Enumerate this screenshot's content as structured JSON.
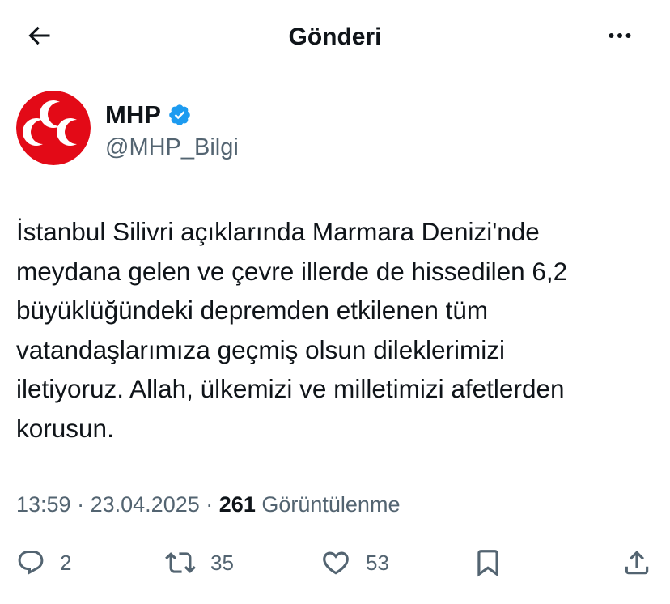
{
  "header": {
    "title": "Gönderi",
    "back_icon": "arrow-left-icon",
    "more_icon": "more-horizontal-icon"
  },
  "author": {
    "display_name": "MHP",
    "handle": "@MHP_Bilgi",
    "verified": true,
    "avatar_icon": "three-crescents-logo",
    "avatar_colors": {
      "background": "#e30a17",
      "foreground": "#ffffff"
    }
  },
  "tweet": {
    "lines": [
      "İstanbul Silivri açıklarında Marmara Denizi'nde",
      "meydana gelen ve çevre illerde de hissedilen 6,2",
      "büyüklüğündeki depremden etkilenen tüm",
      "vatandaşlarımıza geçmiş olsun dileklerimizi",
      "iletiyoruz. Allah, ülkemizi ve milletimizi afetlerden",
      "korusun."
    ]
  },
  "meta": {
    "time": "13:59",
    "separator": "·",
    "date": "23.04.2025",
    "views_count": "261",
    "views_label": "Görüntülenme"
  },
  "actions": {
    "reply": {
      "icon": "reply-icon",
      "count": "2"
    },
    "retweet": {
      "icon": "retweet-icon",
      "count": "35"
    },
    "like": {
      "icon": "heart-icon",
      "count": "53"
    },
    "bookmark": {
      "icon": "bookmark-icon"
    },
    "share": {
      "icon": "share-icon"
    }
  },
  "colors": {
    "text": "#0f1419",
    "secondary": "#536471",
    "verified": "#1d9bf0",
    "brand_red": "#e30a17"
  }
}
